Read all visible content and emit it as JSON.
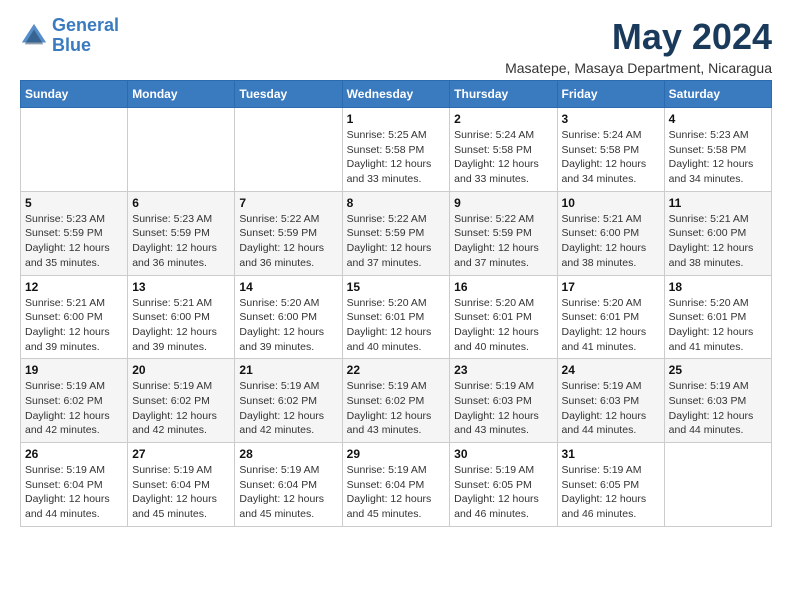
{
  "logo": {
    "line1": "General",
    "line2": "Blue"
  },
  "title": "May 2024",
  "subtitle": "Masatepe, Masaya Department, Nicaragua",
  "weekdays": [
    "Sunday",
    "Monday",
    "Tuesday",
    "Wednesday",
    "Thursday",
    "Friday",
    "Saturday"
  ],
  "weeks": [
    [
      {
        "day": "",
        "sunrise": "",
        "sunset": "",
        "daylight": ""
      },
      {
        "day": "",
        "sunrise": "",
        "sunset": "",
        "daylight": ""
      },
      {
        "day": "",
        "sunrise": "",
        "sunset": "",
        "daylight": ""
      },
      {
        "day": "1",
        "sunrise": "Sunrise: 5:25 AM",
        "sunset": "Sunset: 5:58 PM",
        "daylight": "Daylight: 12 hours and 33 minutes."
      },
      {
        "day": "2",
        "sunrise": "Sunrise: 5:24 AM",
        "sunset": "Sunset: 5:58 PM",
        "daylight": "Daylight: 12 hours and 33 minutes."
      },
      {
        "day": "3",
        "sunrise": "Sunrise: 5:24 AM",
        "sunset": "Sunset: 5:58 PM",
        "daylight": "Daylight: 12 hours and 34 minutes."
      },
      {
        "day": "4",
        "sunrise": "Sunrise: 5:23 AM",
        "sunset": "Sunset: 5:58 PM",
        "daylight": "Daylight: 12 hours and 34 minutes."
      }
    ],
    [
      {
        "day": "5",
        "sunrise": "Sunrise: 5:23 AM",
        "sunset": "Sunset: 5:59 PM",
        "daylight": "Daylight: 12 hours and 35 minutes."
      },
      {
        "day": "6",
        "sunrise": "Sunrise: 5:23 AM",
        "sunset": "Sunset: 5:59 PM",
        "daylight": "Daylight: 12 hours and 36 minutes."
      },
      {
        "day": "7",
        "sunrise": "Sunrise: 5:22 AM",
        "sunset": "Sunset: 5:59 PM",
        "daylight": "Daylight: 12 hours and 36 minutes."
      },
      {
        "day": "8",
        "sunrise": "Sunrise: 5:22 AM",
        "sunset": "Sunset: 5:59 PM",
        "daylight": "Daylight: 12 hours and 37 minutes."
      },
      {
        "day": "9",
        "sunrise": "Sunrise: 5:22 AM",
        "sunset": "Sunset: 5:59 PM",
        "daylight": "Daylight: 12 hours and 37 minutes."
      },
      {
        "day": "10",
        "sunrise": "Sunrise: 5:21 AM",
        "sunset": "Sunset: 6:00 PM",
        "daylight": "Daylight: 12 hours and 38 minutes."
      },
      {
        "day": "11",
        "sunrise": "Sunrise: 5:21 AM",
        "sunset": "Sunset: 6:00 PM",
        "daylight": "Daylight: 12 hours and 38 minutes."
      }
    ],
    [
      {
        "day": "12",
        "sunrise": "Sunrise: 5:21 AM",
        "sunset": "Sunset: 6:00 PM",
        "daylight": "Daylight: 12 hours and 39 minutes."
      },
      {
        "day": "13",
        "sunrise": "Sunrise: 5:21 AM",
        "sunset": "Sunset: 6:00 PM",
        "daylight": "Daylight: 12 hours and 39 minutes."
      },
      {
        "day": "14",
        "sunrise": "Sunrise: 5:20 AM",
        "sunset": "Sunset: 6:00 PM",
        "daylight": "Daylight: 12 hours and 39 minutes."
      },
      {
        "day": "15",
        "sunrise": "Sunrise: 5:20 AM",
        "sunset": "Sunset: 6:01 PM",
        "daylight": "Daylight: 12 hours and 40 minutes."
      },
      {
        "day": "16",
        "sunrise": "Sunrise: 5:20 AM",
        "sunset": "Sunset: 6:01 PM",
        "daylight": "Daylight: 12 hours and 40 minutes."
      },
      {
        "day": "17",
        "sunrise": "Sunrise: 5:20 AM",
        "sunset": "Sunset: 6:01 PM",
        "daylight": "Daylight: 12 hours and 41 minutes."
      },
      {
        "day": "18",
        "sunrise": "Sunrise: 5:20 AM",
        "sunset": "Sunset: 6:01 PM",
        "daylight": "Daylight: 12 hours and 41 minutes."
      }
    ],
    [
      {
        "day": "19",
        "sunrise": "Sunrise: 5:19 AM",
        "sunset": "Sunset: 6:02 PM",
        "daylight": "Daylight: 12 hours and 42 minutes."
      },
      {
        "day": "20",
        "sunrise": "Sunrise: 5:19 AM",
        "sunset": "Sunset: 6:02 PM",
        "daylight": "Daylight: 12 hours and 42 minutes."
      },
      {
        "day": "21",
        "sunrise": "Sunrise: 5:19 AM",
        "sunset": "Sunset: 6:02 PM",
        "daylight": "Daylight: 12 hours and 42 minutes."
      },
      {
        "day": "22",
        "sunrise": "Sunrise: 5:19 AM",
        "sunset": "Sunset: 6:02 PM",
        "daylight": "Daylight: 12 hours and 43 minutes."
      },
      {
        "day": "23",
        "sunrise": "Sunrise: 5:19 AM",
        "sunset": "Sunset: 6:03 PM",
        "daylight": "Daylight: 12 hours and 43 minutes."
      },
      {
        "day": "24",
        "sunrise": "Sunrise: 5:19 AM",
        "sunset": "Sunset: 6:03 PM",
        "daylight": "Daylight: 12 hours and 44 minutes."
      },
      {
        "day": "25",
        "sunrise": "Sunrise: 5:19 AM",
        "sunset": "Sunset: 6:03 PM",
        "daylight": "Daylight: 12 hours and 44 minutes."
      }
    ],
    [
      {
        "day": "26",
        "sunrise": "Sunrise: 5:19 AM",
        "sunset": "Sunset: 6:04 PM",
        "daylight": "Daylight: 12 hours and 44 minutes."
      },
      {
        "day": "27",
        "sunrise": "Sunrise: 5:19 AM",
        "sunset": "Sunset: 6:04 PM",
        "daylight": "Daylight: 12 hours and 45 minutes."
      },
      {
        "day": "28",
        "sunrise": "Sunrise: 5:19 AM",
        "sunset": "Sunset: 6:04 PM",
        "daylight": "Daylight: 12 hours and 45 minutes."
      },
      {
        "day": "29",
        "sunrise": "Sunrise: 5:19 AM",
        "sunset": "Sunset: 6:04 PM",
        "daylight": "Daylight: 12 hours and 45 minutes."
      },
      {
        "day": "30",
        "sunrise": "Sunrise: 5:19 AM",
        "sunset": "Sunset: 6:05 PM",
        "daylight": "Daylight: 12 hours and 46 minutes."
      },
      {
        "day": "31",
        "sunrise": "Sunrise: 5:19 AM",
        "sunset": "Sunset: 6:05 PM",
        "daylight": "Daylight: 12 hours and 46 minutes."
      },
      {
        "day": "",
        "sunrise": "",
        "sunset": "",
        "daylight": ""
      }
    ]
  ]
}
